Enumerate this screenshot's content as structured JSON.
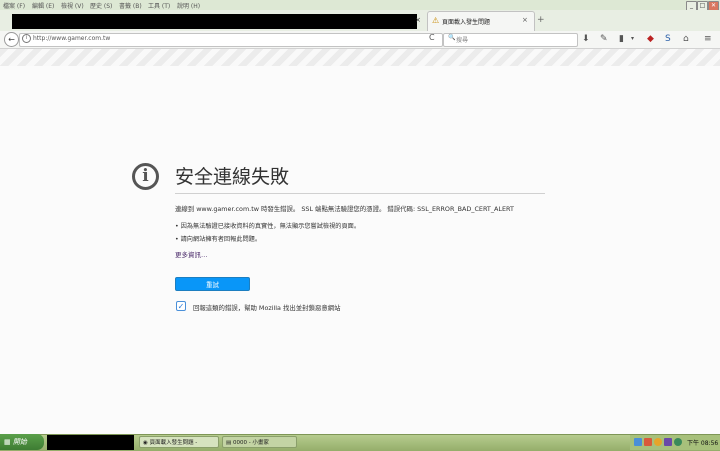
{
  "menu": [
    "檔案 (F)",
    "編輯 (E)",
    "檢視 (V)",
    "歷史 (S)",
    "書籤 (B)",
    "工具 (T)",
    "說明 (H)"
  ],
  "window_buttons": {
    "minimize": "_",
    "restore": "□",
    "close": "✕"
  },
  "tab": {
    "title": "頁面載入發生問題",
    "close": "×",
    "new_tab": "+"
  },
  "nav": {
    "back": "←",
    "url": "http://www.gamer.com.tw",
    "search_placeholder": "搜尋",
    "reload": "C"
  },
  "page": {
    "title": "安全連線失敗",
    "description": "連線到 www.gamer.com.tw 時發生錯誤。 SSL 端點無法驗證您的憑證。 錯誤代碼: SSL_ERROR_BAD_CERT_ALERT",
    "bullets": [
      "因為無法驗證已接收資料的真實性，無法顯示您嘗試檢視的頁面。",
      "請向網站擁有者回報此問題。"
    ],
    "more_info": "更多資訊…",
    "retry_label": "重試",
    "report_checked": true,
    "report_label": "回報這類的錯誤，幫助 Mozilla 找出並封鎖惡意網站"
  },
  "taskbar": {
    "start_label": "開始",
    "task_firefox": "頁面載入發生問題 -",
    "task_folder": "0000 - 小畫家",
    "clock": "下午 08:56"
  },
  "colors": {
    "retry_button": "#0996f8",
    "taskbar": "#a7c07b",
    "start": "#4a8f3d"
  }
}
